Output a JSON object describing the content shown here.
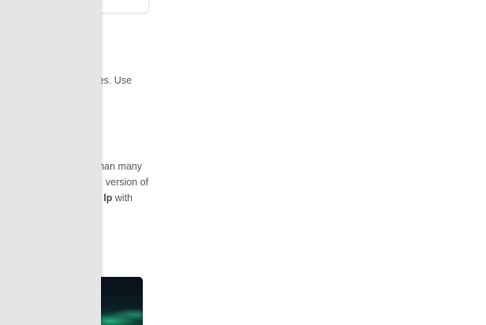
{
  "content": {
    "paragraph_1": {
      "line_1": "es. Use"
    },
    "paragraph_2": {
      "line_1": "han many",
      "line_2": "version of",
      "line_3_bold": "lp",
      "line_3_rest": " with"
    }
  },
  "colors": {
    "side_panel": "#e5e5e5",
    "text": "#555555",
    "background": "#ffffff"
  }
}
